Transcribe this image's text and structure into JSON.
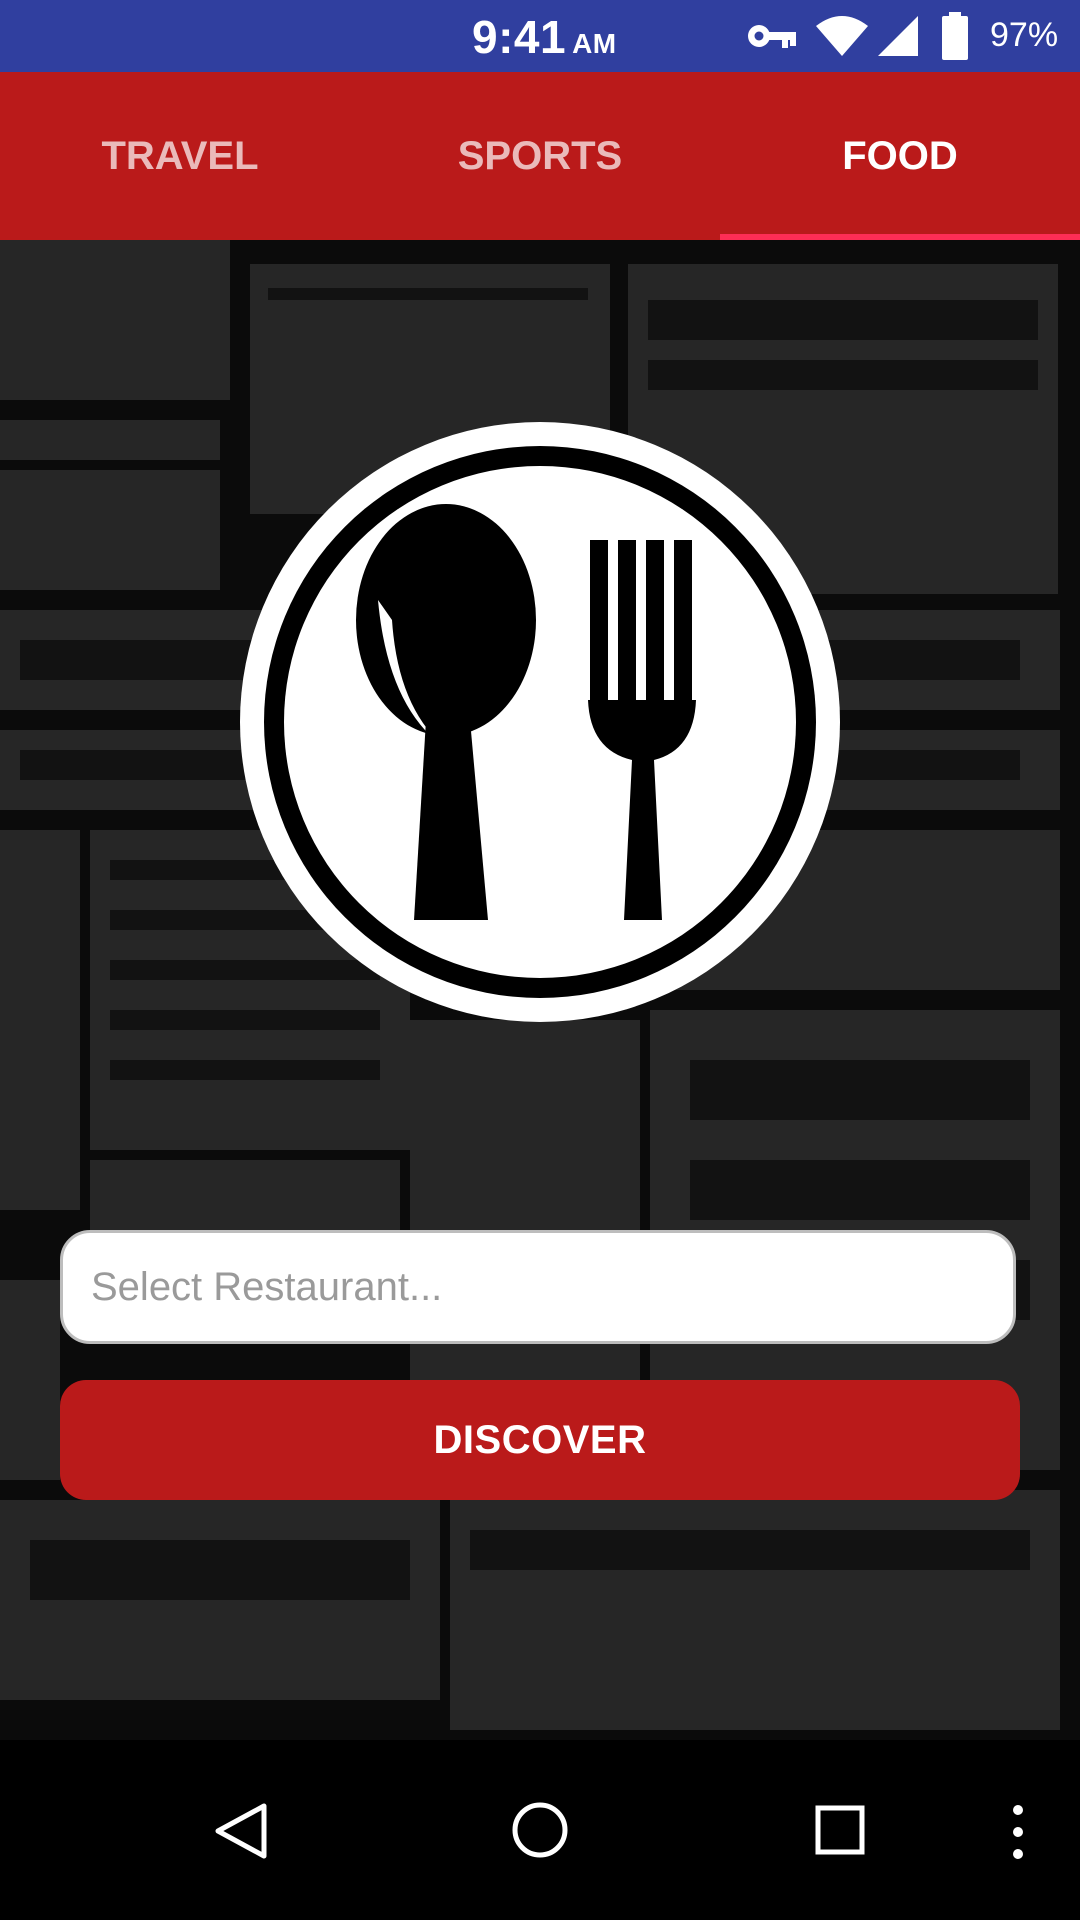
{
  "status_bar": {
    "time": "9:41",
    "ampm": "AM",
    "battery_percent": "97%",
    "icons": [
      "vpn-key-icon",
      "wifi-icon",
      "signal-icon",
      "battery-icon"
    ]
  },
  "tabs": [
    {
      "label": "TRAVEL",
      "active": false
    },
    {
      "label": "SPORTS",
      "active": false
    },
    {
      "label": "FOOD",
      "active": true
    }
  ],
  "colors": {
    "status_bar": "#303F9F",
    "primary": "#BA1A1A",
    "tab_indicator": "#FF2D55"
  },
  "content": {
    "logo_icon": "spoon-fork-plate-icon",
    "select": {
      "placeholder": "Select Restaurant..."
    },
    "discover_label": "DISCOVER"
  },
  "nav_bar": {
    "icons": [
      "back-icon",
      "home-icon",
      "recents-icon",
      "more-icon"
    ]
  }
}
